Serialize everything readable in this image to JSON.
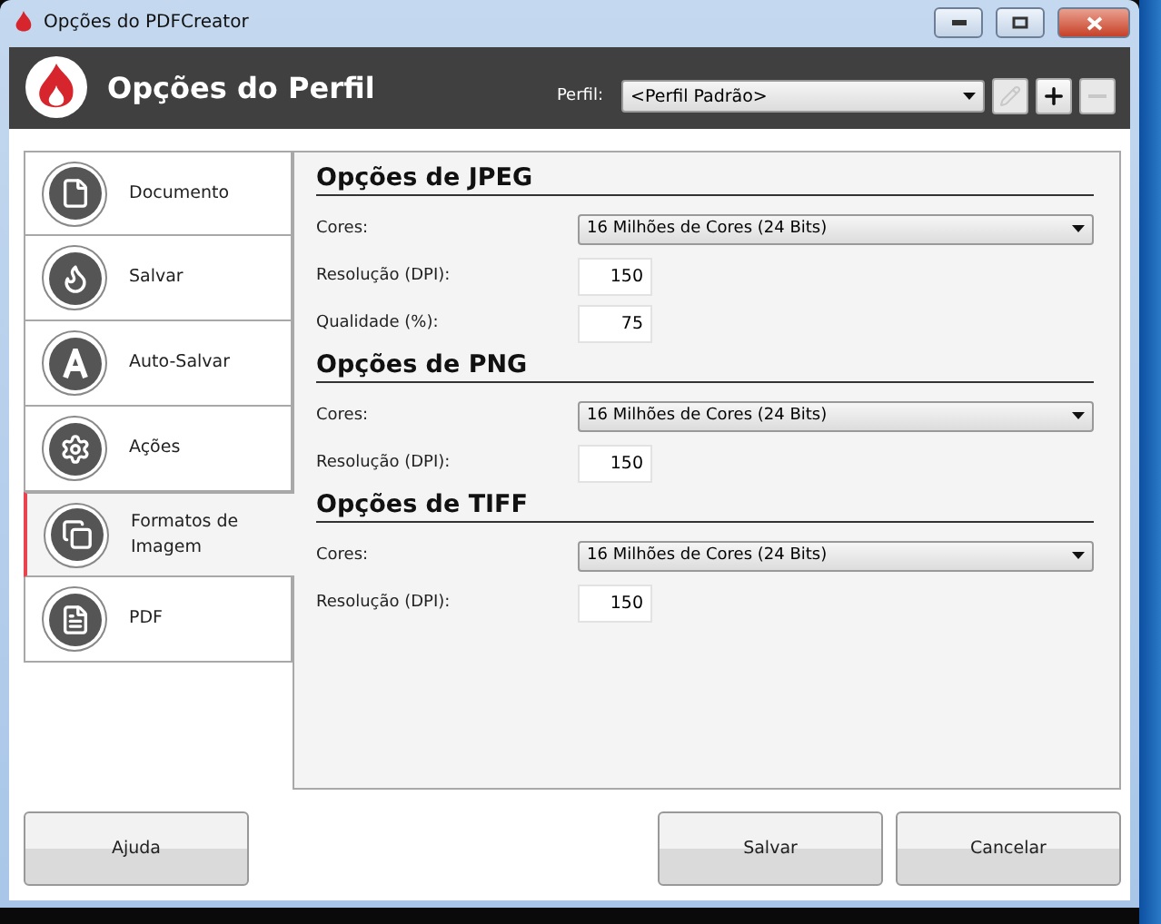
{
  "window": {
    "title": "Opções do PDFCreator"
  },
  "header": {
    "title": "Opções do Perfil",
    "profile_label": "Perfil:",
    "profile_value": "<Perfil Padrão>",
    "tools": [
      {
        "kind": "edit",
        "disabled": true
      },
      {
        "kind": "add",
        "disabled": false
      },
      {
        "kind": "remove",
        "disabled": true
      }
    ]
  },
  "sidebar": {
    "items": [
      {
        "label": "Documento",
        "selected": false
      },
      {
        "label": "Salvar",
        "selected": false
      },
      {
        "label": "Auto-Salvar",
        "selected": false
      },
      {
        "label": "Ações",
        "selected": false
      },
      {
        "label": "Formatos de Imagem",
        "selected": true
      },
      {
        "label": "PDF",
        "selected": false
      }
    ]
  },
  "sections": [
    {
      "title": "Opções de JPEG",
      "rows": [
        {
          "kind": "select",
          "label": "Cores:",
          "value": "16 Milhões de Cores (24 Bits)"
        },
        {
          "kind": "number",
          "label": "Resolução (DPI):",
          "value": "150"
        },
        {
          "kind": "number",
          "label": "Qualidade (%):",
          "value": "75"
        }
      ]
    },
    {
      "title": "Opções de PNG",
      "rows": [
        {
          "kind": "select",
          "label": "Cores:",
          "value": "16 Milhões de Cores (24 Bits)"
        },
        {
          "kind": "number",
          "label": "Resolução (DPI):",
          "value": "150"
        }
      ]
    },
    {
      "title": "Opções de TIFF",
      "rows": [
        {
          "kind": "select",
          "label": "Cores:",
          "value": "16 Milhões de Cores (24 Bits)"
        },
        {
          "kind": "number",
          "label": "Resolução (DPI):",
          "value": "150"
        }
      ]
    }
  ],
  "buttons": {
    "left": [
      "Ajuda"
    ],
    "right": [
      "Salvar",
      "Cancelar"
    ]
  }
}
